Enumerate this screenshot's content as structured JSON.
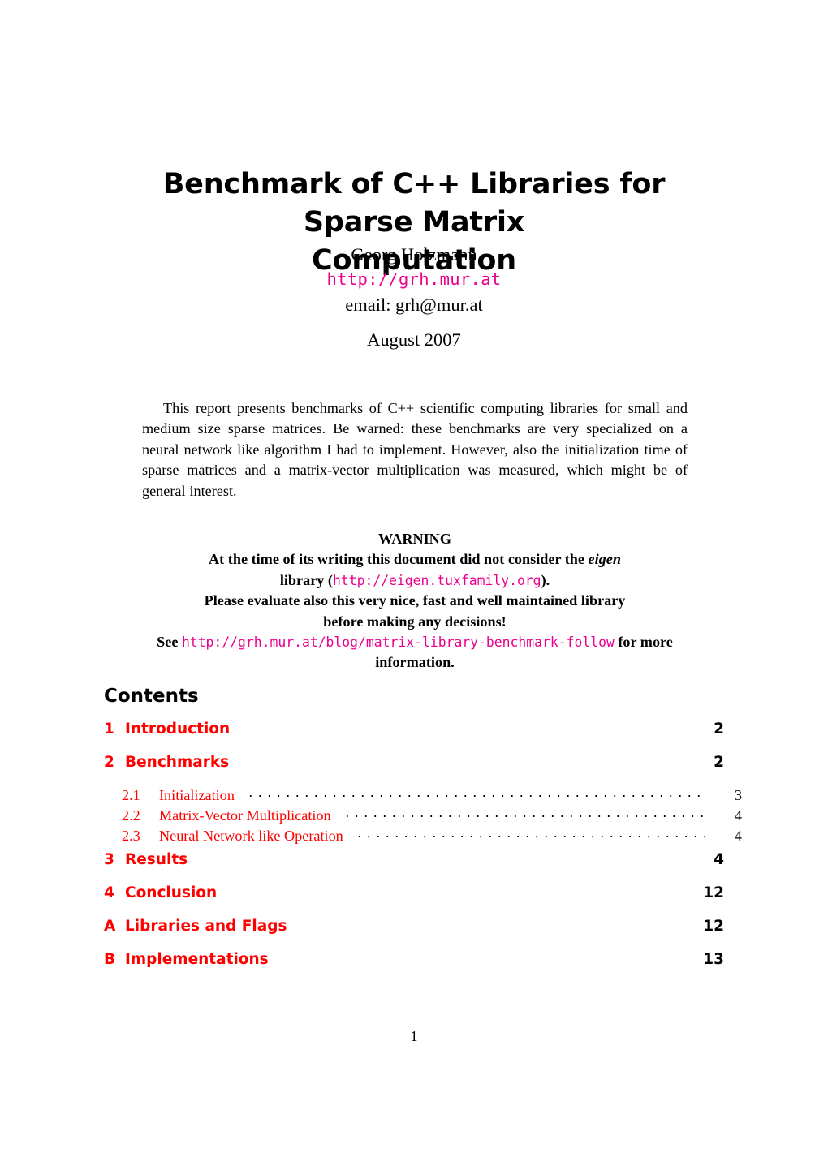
{
  "document": {
    "title_line1": "Benchmark of C++ Libraries for Sparse Matrix",
    "title_line2": "Computation",
    "author": "Georg Holzmann",
    "author_url": "http://grh.mur.at",
    "author_email": "email: grh@mur.at",
    "date": "August 2007",
    "page_number": "1"
  },
  "abstract": {
    "text": "This report presents benchmarks of C++ scientific computing libraries for small and medium size sparse matrices. Be warned: these benchmarks are very specialized on a neural network like algorithm I had to implement. However, also the initialization time of sparse matrices and a matrix-vector multiplication was measured, which might be of general interest."
  },
  "warning": {
    "heading": "WARNING",
    "line1_before": "At the time of its writing this document did not consider the ",
    "line1_emph": "eigen",
    "line2_before": "library (",
    "line2_url": "http://eigen.tuxfamily.org",
    "line2_after": ").",
    "line3": "Please evaluate also this very nice, fast and well maintained library",
    "line4": "before making any decisions!",
    "line5_before": "See ",
    "line5_url": "http://grh.mur.at/blog/matrix-library-benchmark-follow",
    "line5_after": " for more",
    "line6": "information."
  },
  "contents": {
    "heading": "Contents",
    "entries": [
      {
        "type": "section",
        "num": "1",
        "label": "Introduction",
        "page": "2"
      },
      {
        "type": "section",
        "num": "2",
        "label": "Benchmarks",
        "page": "2"
      },
      {
        "type": "subsection",
        "num": "2.1",
        "label": "Initialization",
        "page": "3"
      },
      {
        "type": "subsection",
        "num": "2.2",
        "label": "Matrix-Vector Multiplication",
        "page": "4"
      },
      {
        "type": "subsection",
        "num": "2.3",
        "label": "Neural Network like Operation",
        "page": "4"
      },
      {
        "type": "section",
        "num": "3",
        "label": "Results",
        "page": "4"
      },
      {
        "type": "section",
        "num": "4",
        "label": "Conclusion",
        "page": "12"
      },
      {
        "type": "section",
        "num": "A",
        "label": "Libraries and Flags",
        "page": "12"
      },
      {
        "type": "section",
        "num": "B",
        "label": "Implementations",
        "page": "13"
      }
    ]
  },
  "colors": {
    "link_red": "#ff0000",
    "url_magenta": "#ec008c",
    "text_black": "#000000"
  }
}
